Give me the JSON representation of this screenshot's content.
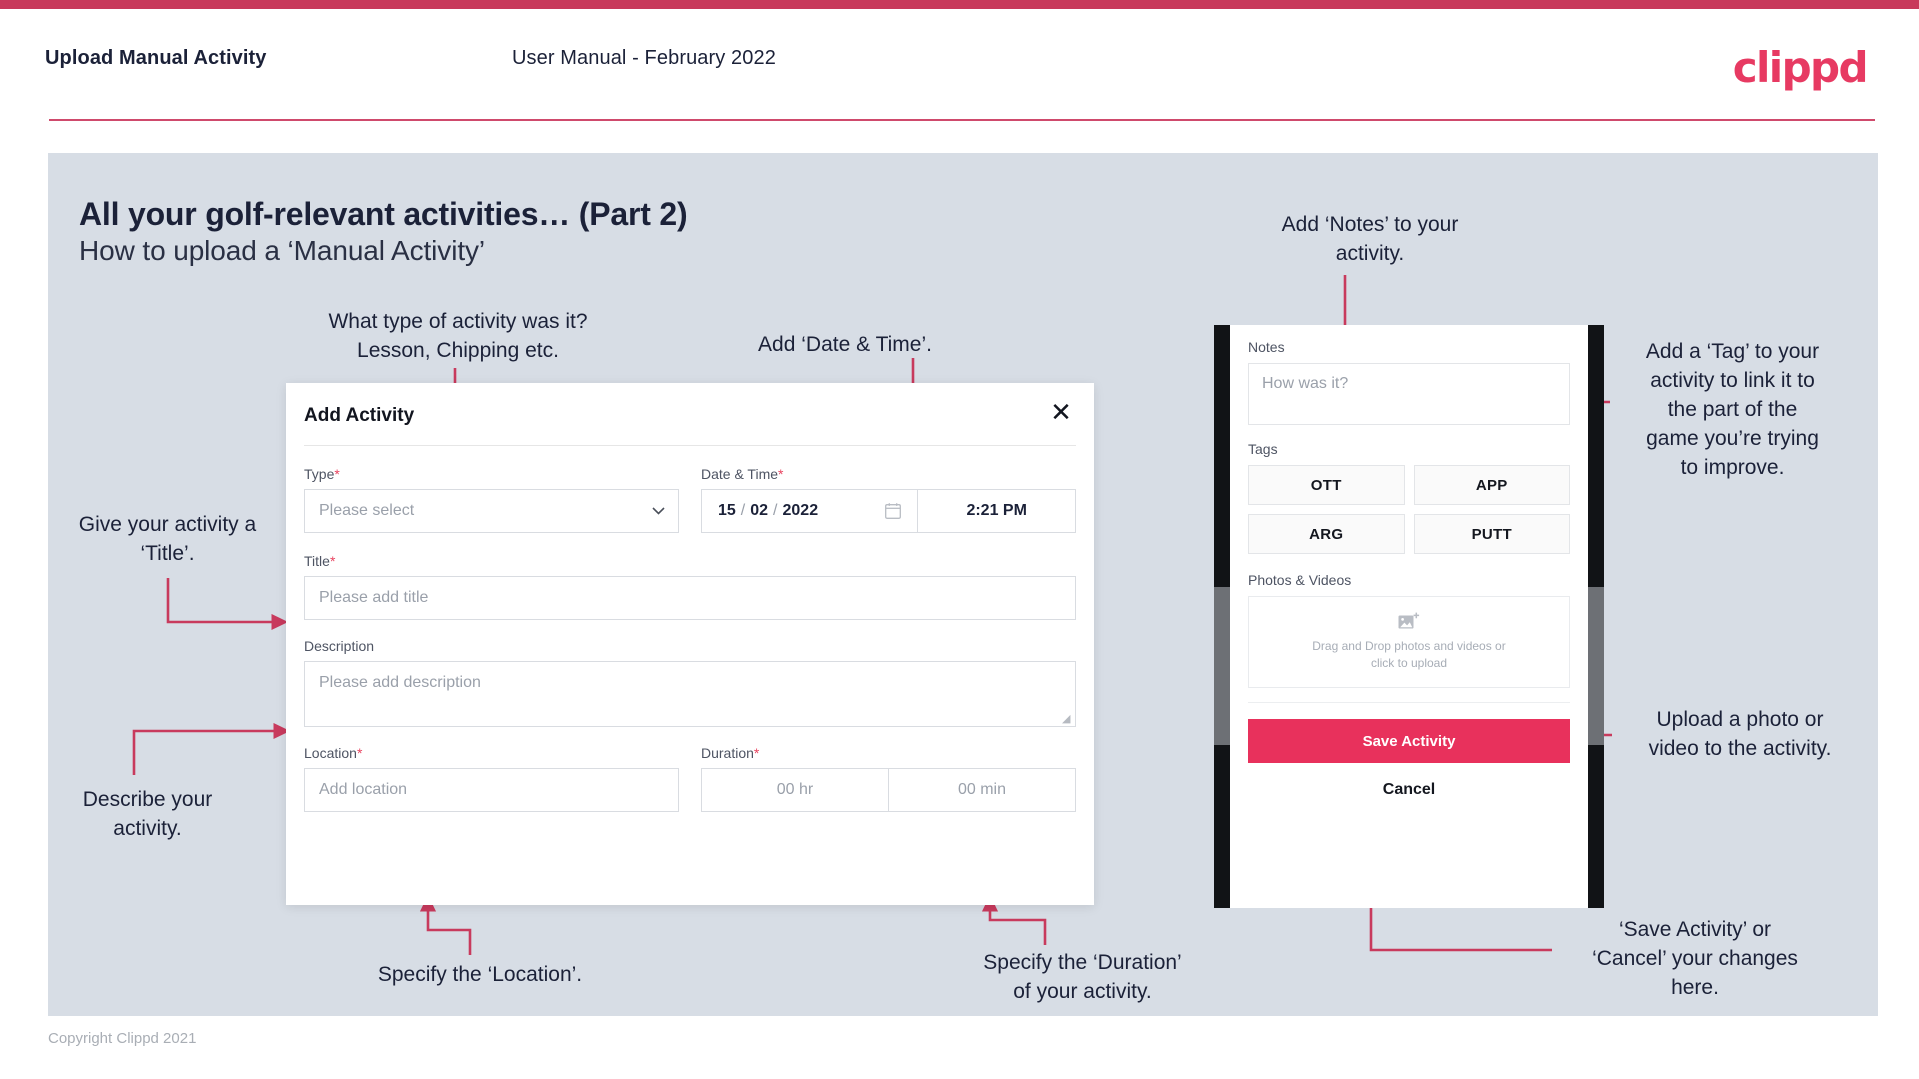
{
  "header": {
    "title": "Upload Manual Activity",
    "subtitle": "User Manual - February 2022",
    "brand": "clippd"
  },
  "slide": {
    "title": "All your golf-relevant activities… (Part 2)",
    "subtitle": "How to upload a ‘Manual Activity’"
  },
  "annotations": {
    "type_hint": "What type of activity was it?\nLesson, Chipping etc.",
    "datetime_hint": "Add ‘Date & Time’.",
    "title_hint": "Give your activity a\n‘Title’.",
    "description_hint": "Describe your\nactivity.",
    "location_hint": "Specify the ‘Location’.",
    "duration_hint": "Specify the ‘Duration’\nof your activity.",
    "notes_hint": "Add ‘Notes’ to your\nactivity.",
    "tag_hint": "Add a ‘Tag’ to your\nactivity to link it to\nthe part of the\ngame you’re trying\nto improve.",
    "upload_hint": "Upload a photo or\nvideo to the activity.",
    "save_hint": "‘Save Activity’ or\n‘Cancel’ your changes\nhere."
  },
  "dialog": {
    "title": "Add Activity",
    "close_icon": "close-icon",
    "fields": {
      "type": {
        "label": "Type",
        "required": "*",
        "placeholder": "Please select"
      },
      "datetime": {
        "label": "Date & Time",
        "required": "*",
        "day": "15",
        "month": "02",
        "year": "2022",
        "time": "2:21 PM"
      },
      "title": {
        "label": "Title",
        "required": "*",
        "placeholder": "Please add title"
      },
      "description": {
        "label": "Description",
        "required": "",
        "placeholder": "Please add description"
      },
      "location": {
        "label": "Location",
        "required": "*",
        "placeholder": "Add location"
      },
      "duration": {
        "label": "Duration",
        "required": "*",
        "hours_placeholder": "00 hr",
        "minutes_placeholder": "00 min"
      }
    }
  },
  "phone": {
    "notes": {
      "label": "Notes",
      "placeholder": "How was it?"
    },
    "tags": {
      "label": "Tags",
      "items": [
        "OTT",
        "APP",
        "ARG",
        "PUTT"
      ]
    },
    "photos": {
      "label": "Photos & Videos",
      "dropzone_text": "Drag and Drop photos and videos or click to upload"
    },
    "save_label": "Save Activity",
    "cancel_label": "Cancel"
  },
  "footer": {
    "copyright": "Copyright Clippd 2021"
  },
  "colors": {
    "brand_pink": "#e73a62",
    "accent_red": "#c8395b",
    "save_button": "#e8315c",
    "slide_bg": "#d7dde5",
    "text_dark": "#1b2138"
  }
}
